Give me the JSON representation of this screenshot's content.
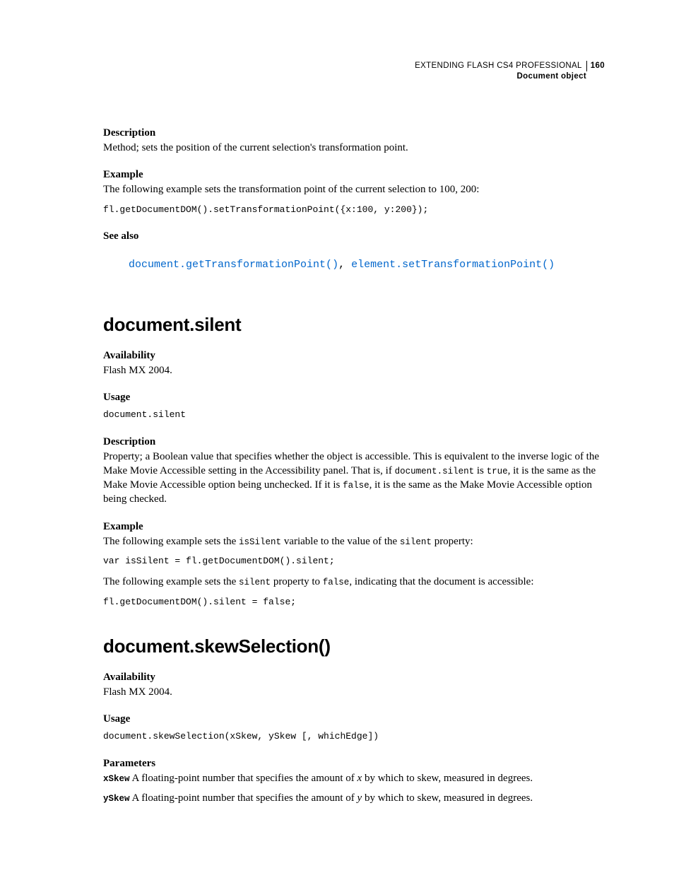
{
  "header": {
    "book_title": "EXTENDING FLASH CS4 PROFESSIONAL",
    "page_number": "160",
    "section": "Document object"
  },
  "sec1": {
    "desc_label": "Description",
    "desc_body": "Method; sets the position of the current selection's transformation point.",
    "example_label": "Example",
    "example_body": "The following example sets the transformation point of the current selection to 100, 200:",
    "example_code": "fl.getDocumentDOM().setTransformationPoint({x:100, y:200});",
    "seealso_label": "See also",
    "seealso_link1": "document.getTransformationPoint()",
    "seealso_sep": ", ",
    "seealso_link2": "element.setTransformationPoint()"
  },
  "sec2": {
    "heading": "document.silent",
    "avail_label": "Availability",
    "avail_body": "Flash MX 2004.",
    "usage_label": "Usage",
    "usage_code": "document.silent",
    "desc_label": "Description",
    "desc_pre": "Property; a Boolean value that specifies whether the object is accessible. This is equivalent to the inverse logic of the Make Movie Accessible setting in the Accessibility panel. That is, if ",
    "desc_c1": "document.silent",
    "desc_mid1": " is ",
    "desc_c2": "true",
    "desc_mid2": ", it is the same as the Make Movie Accessible option being unchecked. If it is ",
    "desc_c3": "false",
    "desc_post": ", it is the same as the Make Movie Accessible option being checked.",
    "example_label": "Example",
    "ex1_pre": "The following example sets the ",
    "ex1_c1": "isSilent",
    "ex1_mid": " variable to the value of the ",
    "ex1_c2": "silent",
    "ex1_post": " property:",
    "ex1_code": "var isSilent = fl.getDocumentDOM().silent;",
    "ex2_pre": "The following example sets the ",
    "ex2_c1": "silent",
    "ex2_mid": " property to ",
    "ex2_c2": "false",
    "ex2_post": ", indicating that the document is accessible:",
    "ex2_code": "fl.getDocumentDOM().silent = false;"
  },
  "sec3": {
    "heading": "document.skewSelection()",
    "avail_label": "Availability",
    "avail_body": "Flash MX 2004.",
    "usage_label": "Usage",
    "usage_code": "document.skewSelection(xSkew, ySkew [, whichEdge])",
    "params_label": "Parameters",
    "p1_name": "xSkew",
    "p1_pre": "  A floating-point number that specifies the amount of ",
    "p1_var": "x",
    "p1_post": " by which to skew, measured in degrees.",
    "p2_name": "ySkew",
    "p2_pre": "  A floating-point number that specifies the amount of ",
    "p2_var": "y",
    "p2_post": " by which to skew, measured in degrees."
  }
}
